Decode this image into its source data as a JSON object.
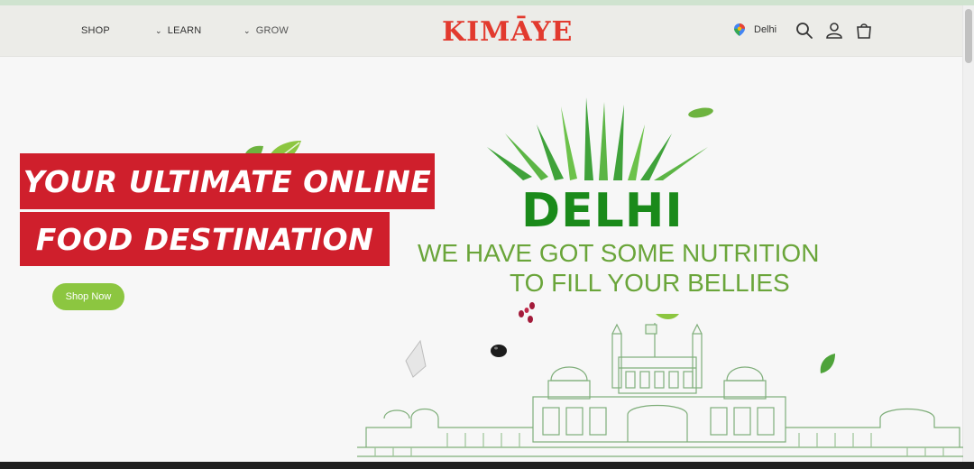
{
  "header": {
    "nav": [
      {
        "label": "SHOP"
      },
      {
        "label": "LEARN"
      },
      {
        "label": "GROW"
      }
    ],
    "logo_text": "KIMĀYE",
    "location": "Delhi"
  },
  "hero": {
    "banner_line1": "YOUR ULTIMATE ONLINE",
    "banner_line2": "FOOD DESTINATION",
    "cta_label": "Shop Now",
    "city": "DELHI",
    "tagline_line1": "WE HAVE GOT SOME NUTRITION",
    "tagline_line2": "TO FILL YOUR BELLIES"
  },
  "colors": {
    "accent_red": "#cf1f2c",
    "accent_green": "#8cc640",
    "city_green": "#1a8a1a"
  }
}
